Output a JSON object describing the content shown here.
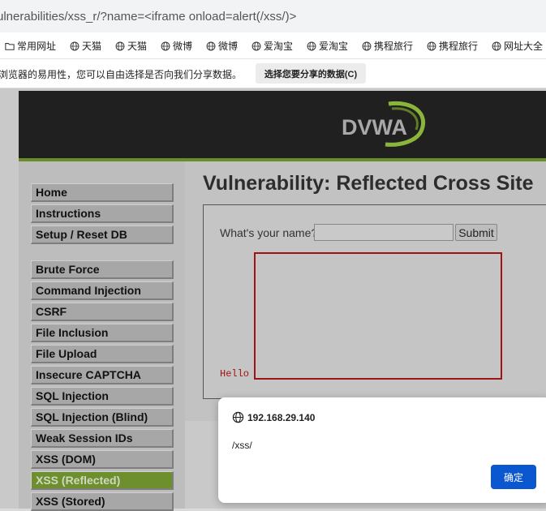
{
  "browser": {
    "url": "ulnerabilities/xss_r/?name=<iframe onload=alert(/xss/)>",
    "bookmarks": [
      {
        "label": "常用网址",
        "icon": "folder-icon"
      },
      {
        "label": "天猫",
        "icon": "globe-icon"
      },
      {
        "label": "天猫",
        "icon": "globe-icon"
      },
      {
        "label": "微博",
        "icon": "globe-icon"
      },
      {
        "label": "微博",
        "icon": "globe-icon"
      },
      {
        "label": "爱淘宝",
        "icon": "globe-icon"
      },
      {
        "label": "爱淘宝",
        "icon": "globe-icon"
      },
      {
        "label": "携程旅行",
        "icon": "globe-icon"
      },
      {
        "label": "携程旅行",
        "icon": "globe-icon"
      },
      {
        "label": "网址大全",
        "icon": "globe-icon"
      }
    ],
    "infobar": {
      "text": "浏览器的易用性，您可以自由选择是否向我们分享数据。",
      "button": "选择您要分享的数据(C)"
    }
  },
  "dvwa": {
    "logo_text": "DVWA",
    "menu_group1": [
      "Home",
      "Instructions",
      "Setup / Reset DB"
    ],
    "menu_group2": [
      "Brute Force",
      "Command Injection",
      "CSRF",
      "File Inclusion",
      "File Upload",
      "Insecure CAPTCHA",
      "SQL Injection",
      "SQL Injection (Blind)",
      "Weak Session IDs",
      "XSS (DOM)",
      "XSS (Reflected)",
      "XSS (Stored)"
    ],
    "selected_item": "XSS (Reflected)",
    "title": "Vulnerability: Reflected Cross Site",
    "form": {
      "label": "What's your name?",
      "input_value": "",
      "submit": "Submit"
    },
    "output": "Hello"
  },
  "alert_dialog": {
    "origin": "192.168.29.140",
    "message": "/xss/",
    "ok_button": "确定"
  },
  "colors": {
    "dvwa_green": "#6a8c2a",
    "header_bg": "#202020",
    "iframe_border": "#9c1414",
    "dialog_button": "#0b57d0"
  }
}
